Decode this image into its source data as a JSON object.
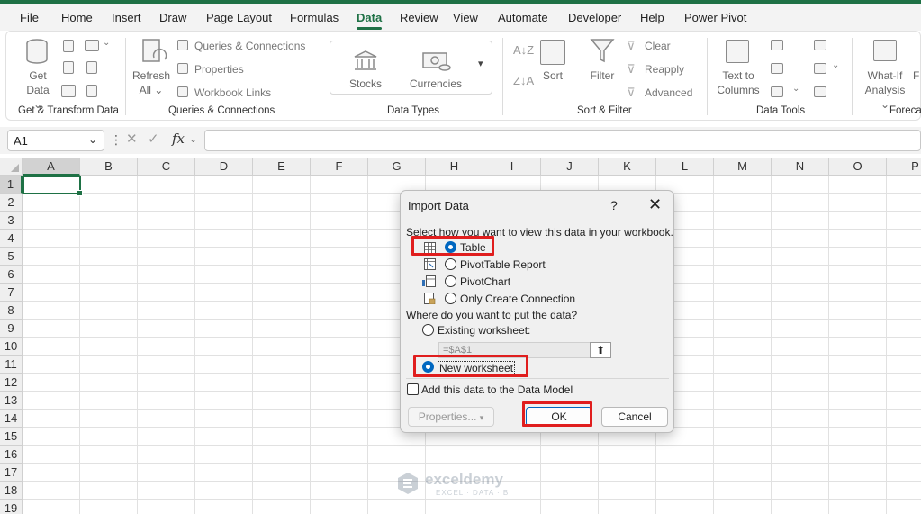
{
  "menu": {
    "tabs": [
      "File",
      "Home",
      "Insert",
      "Draw",
      "Page Layout",
      "Formulas",
      "Data",
      "Review",
      "View",
      "Automate",
      "Developer",
      "Help",
      "Power Pivot"
    ],
    "active": "Data"
  },
  "ribbon": {
    "groups": {
      "get_transform": "Get & Transform Data",
      "queries": "Queries & Connections",
      "data_types": "Data Types",
      "sort_filter": "Sort & Filter",
      "data_tools": "Data Tools",
      "forecast": "Foreca"
    },
    "get_data": [
      "Get",
      "Data"
    ],
    "refresh_all": [
      "Refresh",
      "All"
    ],
    "queries_connections": "Queries & Connections",
    "properties": "Properties",
    "workbook_links": "Workbook Links",
    "stocks": "Stocks",
    "currencies": "Currencies",
    "sort": "Sort",
    "filter": "Filter",
    "clear": "Clear",
    "reapply": "Reapply",
    "advanced": "Advanced",
    "text_to_columns": [
      "Text to",
      "Columns"
    ],
    "what_if": [
      "What-If",
      "Analysis"
    ],
    "f_partial": "F"
  },
  "formula_bar": {
    "name_box": "A1",
    "fx": "fx",
    "formula": ""
  },
  "grid": {
    "columns": [
      "A",
      "B",
      "C",
      "D",
      "E",
      "F",
      "G",
      "H",
      "I",
      "J",
      "K",
      "L",
      "M",
      "N",
      "O",
      "P"
    ],
    "rows": [
      "1",
      "2",
      "3",
      "4",
      "5",
      "6",
      "7",
      "8",
      "9",
      "10",
      "11",
      "12",
      "13",
      "14",
      "15",
      "16",
      "17",
      "18",
      "19"
    ],
    "active_cell": "A1"
  },
  "dialog": {
    "title": "Import Data",
    "help": "?",
    "close": "✕",
    "view_prompt": "Select how you want to view this data in your workbook.",
    "view_options": [
      "Table",
      "PivotTable Report",
      "PivotChart",
      "Only Create Connection"
    ],
    "view_selected": "Table",
    "place_prompt": "Where do you want to put the data?",
    "existing_worksheet": "Existing worksheet:",
    "reference": "=$A$1",
    "new_worksheet": "New worksheet",
    "place_selected": "New worksheet",
    "data_model": "Add this data to the Data Model",
    "data_model_checked": false,
    "properties_button": "Properties...",
    "ok_button": "OK",
    "cancel_button": "Cancel"
  },
  "watermark": {
    "name": "exceldemy",
    "tagline": "EXCEL · DATA · BI"
  },
  "colors": {
    "excel_green": "#1e7145",
    "highlight_red": "#e01e1e",
    "radio_blue": "#0067c0"
  }
}
